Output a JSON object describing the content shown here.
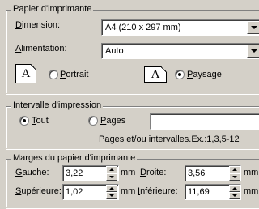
{
  "paper": {
    "legend": "Papier d'imprimante",
    "dimension_label_prefix": "D",
    "dimension_label_rest": "imension:",
    "dimension_value": "A4 (210 x 297 mm)",
    "feed_label_prefix": "A",
    "feed_label_rest": "limentation:",
    "feed_value": "Auto",
    "portrait_prefix": "P",
    "portrait_rest": "ortrait",
    "landscape_prefix": "P",
    "landscape_rest": "aysage",
    "orientation_selected": "Paysage",
    "icon_letter": "A"
  },
  "range": {
    "legend": "Intervalle d'impression",
    "all_prefix": "T",
    "all_rest": "out",
    "pages_prefix": "P",
    "pages_rest": "ages",
    "pages_value": "",
    "hint": "Pages et/ou intervalles.Ex.:1,3,5-12",
    "selected": "Tout"
  },
  "margins": {
    "legend": "Marges du papier d'imprimante",
    "unit": "mm",
    "left_prefix": "G",
    "left_rest": "auche:",
    "left_value": "3,22",
    "right_prefix": "D",
    "right_rest": "roite:",
    "right_value": "3,56",
    "top_prefix": "S",
    "top_rest": "upérieure:",
    "top_value": "1,02",
    "bottom_prefix": "I",
    "bottom_rest": "nférieure:",
    "bottom_value": "11,69"
  },
  "colors": {
    "face": "#d4d0c8",
    "shadow": "#808080",
    "highlight": "#ffffff"
  }
}
